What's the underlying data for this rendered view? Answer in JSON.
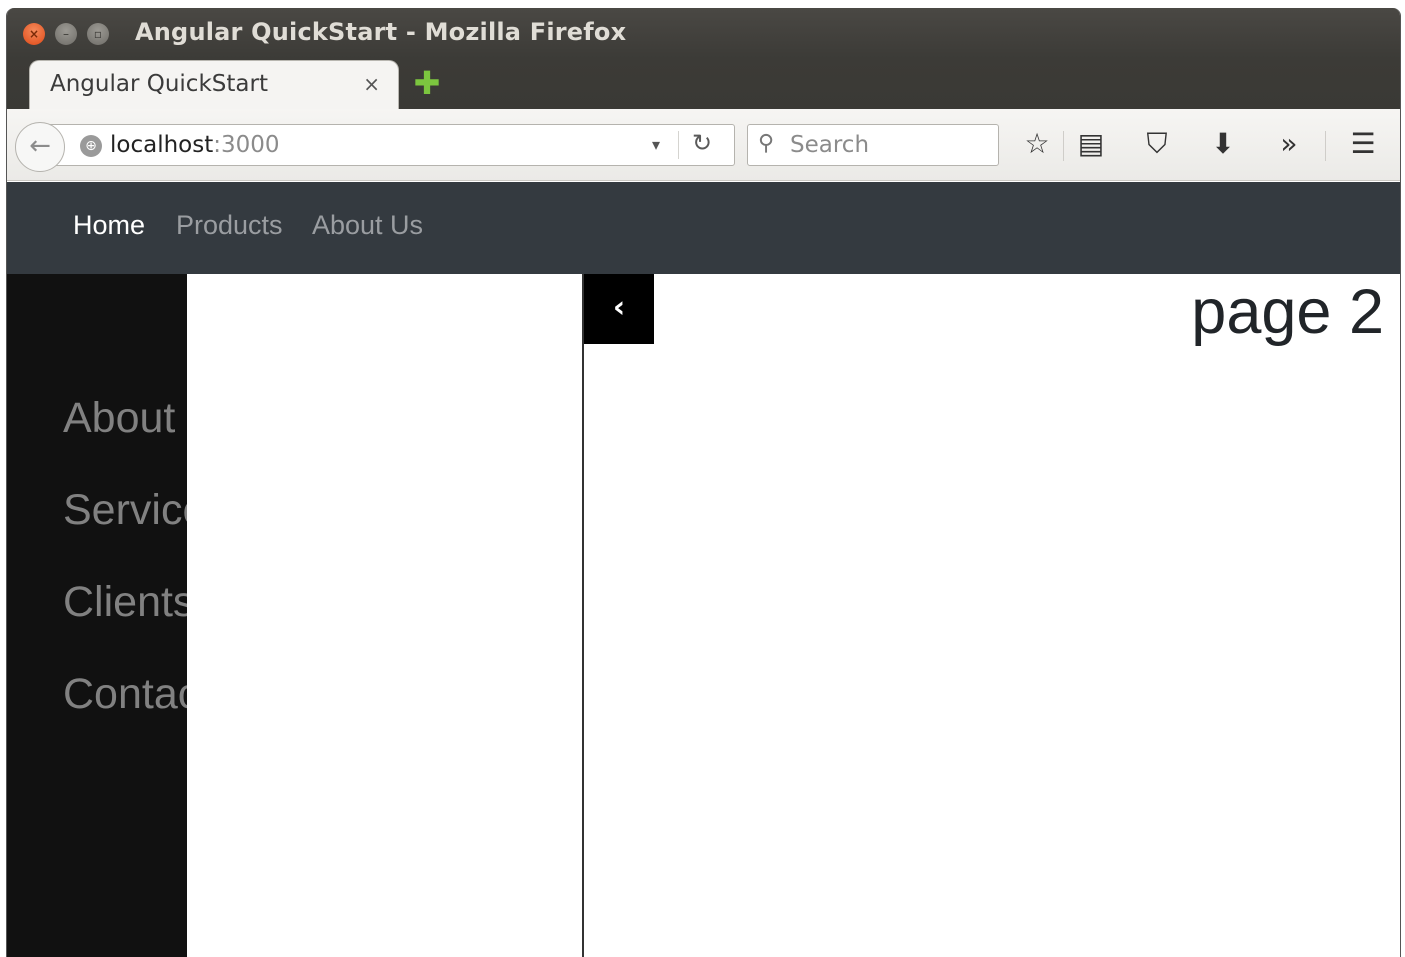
{
  "window": {
    "title": "Angular QuickStart - Mozilla Firefox",
    "close_glyph": "×",
    "minimize_glyph": "–",
    "maximize_glyph": "▫"
  },
  "tab": {
    "label": "Angular QuickStart",
    "close_glyph": "×",
    "new_tab_glyph": "✚"
  },
  "toolbar": {
    "back_glyph": "←",
    "url_host": "localhost",
    "url_port": ":3000",
    "dropdown_glyph": "▾",
    "reload_glyph": "↻",
    "search_placeholder": "Search",
    "search_glyph": "⚲",
    "icons": {
      "bookmark": "☆",
      "reading_list": "▤",
      "pocket": "⛉",
      "download": "⬇",
      "overflow": "»",
      "menu": "☰"
    }
  },
  "navbar": {
    "items": [
      {
        "label": "Home",
        "active": true
      },
      {
        "label": "Products",
        "active": false
      },
      {
        "label": "About Us",
        "active": false
      }
    ]
  },
  "sidebar": {
    "links": [
      "About",
      "Services",
      "Clients",
      "Contact"
    ]
  },
  "toggle": {
    "glyph": "‹"
  },
  "main": {
    "heading": "page 2"
  },
  "colors": {
    "navbar_bg": "#343a40",
    "sidebar_bg": "#111111",
    "sidebar_link": "#818181",
    "toggle_bg": "#000000"
  }
}
